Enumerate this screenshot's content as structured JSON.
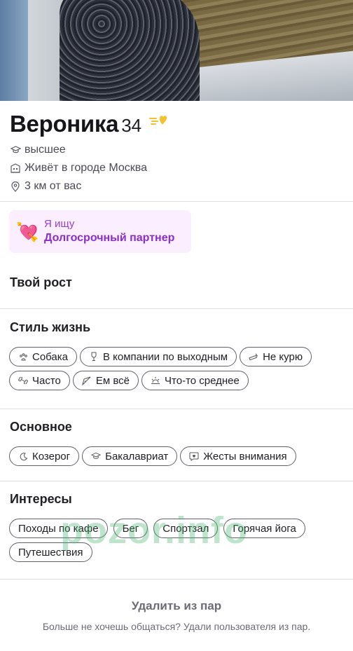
{
  "profile": {
    "name": "Вероника",
    "age": "34",
    "education": "высшее",
    "city": "Живёт в городе Москва",
    "distance": "3 км от вас"
  },
  "seeking": {
    "label": "Я ищу",
    "value": "Долгосрочный партнер"
  },
  "height": {
    "title": "Твой рост"
  },
  "lifestyle": {
    "title": "Стиль жизнь",
    "chips": [
      {
        "label": "Собака",
        "icon": "paw-icon"
      },
      {
        "label": "В компании по выходным",
        "icon": "wine-glass-icon"
      },
      {
        "label": "Не курю",
        "icon": "no-smoking-icon"
      },
      {
        "label": "Часто",
        "icon": "dumbbell-icon"
      },
      {
        "label": "Ем всё",
        "icon": "pizza-icon"
      },
      {
        "label": "Что-то среднее",
        "icon": "sunrise-icon"
      }
    ]
  },
  "basics": {
    "title": "Основное",
    "chips": [
      {
        "label": "Козерог",
        "icon": "moon-icon"
      },
      {
        "label": "Бакалавриат",
        "icon": "graduation-cap-icon"
      },
      {
        "label": "Жесты внимания",
        "icon": "chat-heart-icon"
      }
    ]
  },
  "interests": {
    "title": "Интересы",
    "chips": [
      {
        "label": "Походы по кафе"
      },
      {
        "label": "Бег"
      },
      {
        "label": "Спортзал"
      },
      {
        "label": "Горячая йога"
      },
      {
        "label": "Путешествия"
      }
    ]
  },
  "watermark": "pozor.info",
  "remove": {
    "title": "Удалить из пар",
    "subtitle": "Больше не хочешь общаться? Удали пользователя из пар."
  }
}
